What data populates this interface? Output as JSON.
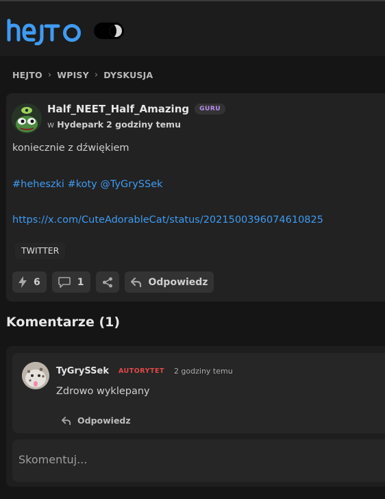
{
  "brand": {
    "logo_text": "hejto",
    "accent": "#3f9bf2"
  },
  "theme_toggle": {
    "icon": "dark-mode-toggle"
  },
  "breadcrumb": [
    "HEJTO",
    "WPISY",
    "DYSKUSJA"
  ],
  "post": {
    "author": "Half_NEET_Half_Amazing",
    "badge": "GURU",
    "meta_prefix": "w",
    "community": "Hydepark",
    "time": "2 godziny temu",
    "text": "koniecznie z dźwiękiem",
    "tags": "#heheszki #koty @TyGrySSek",
    "link": "https://x.com/CuteAdorableCat/status/2021500396074610825",
    "embed_label": "TWITTER",
    "likes": "6",
    "comments": "1",
    "reply_label": "Odpowiedz"
  },
  "comments_section": {
    "title": "Komentarze (1)",
    "items": [
      {
        "author": "TyGrySSek",
        "rank": "AUTORYTET",
        "time": "2 godziny temu",
        "text": "Zdrowo wyklepany",
        "reply_label": "Odpowiedz"
      }
    ],
    "input_placeholder": "Skomentuj..."
  }
}
